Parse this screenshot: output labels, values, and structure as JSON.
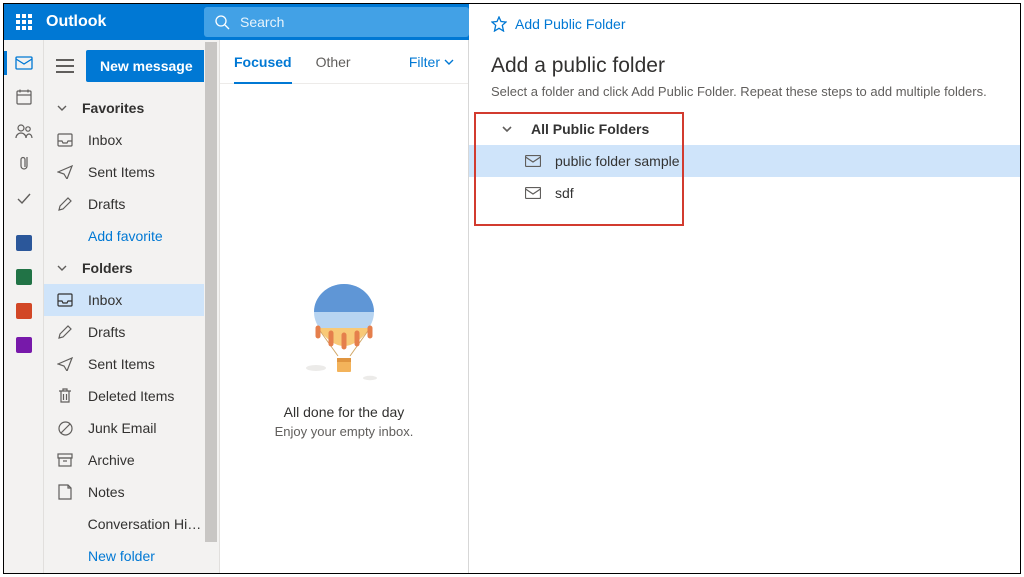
{
  "header": {
    "brand": "Outlook",
    "search_placeholder": "Search"
  },
  "sidebar": {
    "new_message": "New message",
    "favorites_label": "Favorites",
    "folders_label": "Folders",
    "add_favorite": "Add favorite",
    "new_folder": "New folder",
    "favorites": [
      {
        "label": "Inbox"
      },
      {
        "label": "Sent Items"
      },
      {
        "label": "Drafts"
      }
    ],
    "folders": [
      {
        "label": "Inbox",
        "selected": true
      },
      {
        "label": "Drafts"
      },
      {
        "label": "Sent Items"
      },
      {
        "label": "Deleted Items"
      },
      {
        "label": "Junk Email"
      },
      {
        "label": "Archive"
      },
      {
        "label": "Notes"
      },
      {
        "label": "Conversation Hist..."
      }
    ]
  },
  "list": {
    "tab_focused": "Focused",
    "tab_other": "Other",
    "filter": "Filter",
    "empty_title": "All done for the day",
    "empty_sub": "Enjoy your empty inbox."
  },
  "panel": {
    "add_link": "Add Public Folder",
    "title": "Add a public folder",
    "desc": "Select a folder and click Add Public Folder. Repeat these steps to add multiple folders.",
    "tree_root": "All Public Folders",
    "tree": [
      {
        "label": "public folder sample",
        "selected": true
      },
      {
        "label": "sdf"
      }
    ]
  }
}
